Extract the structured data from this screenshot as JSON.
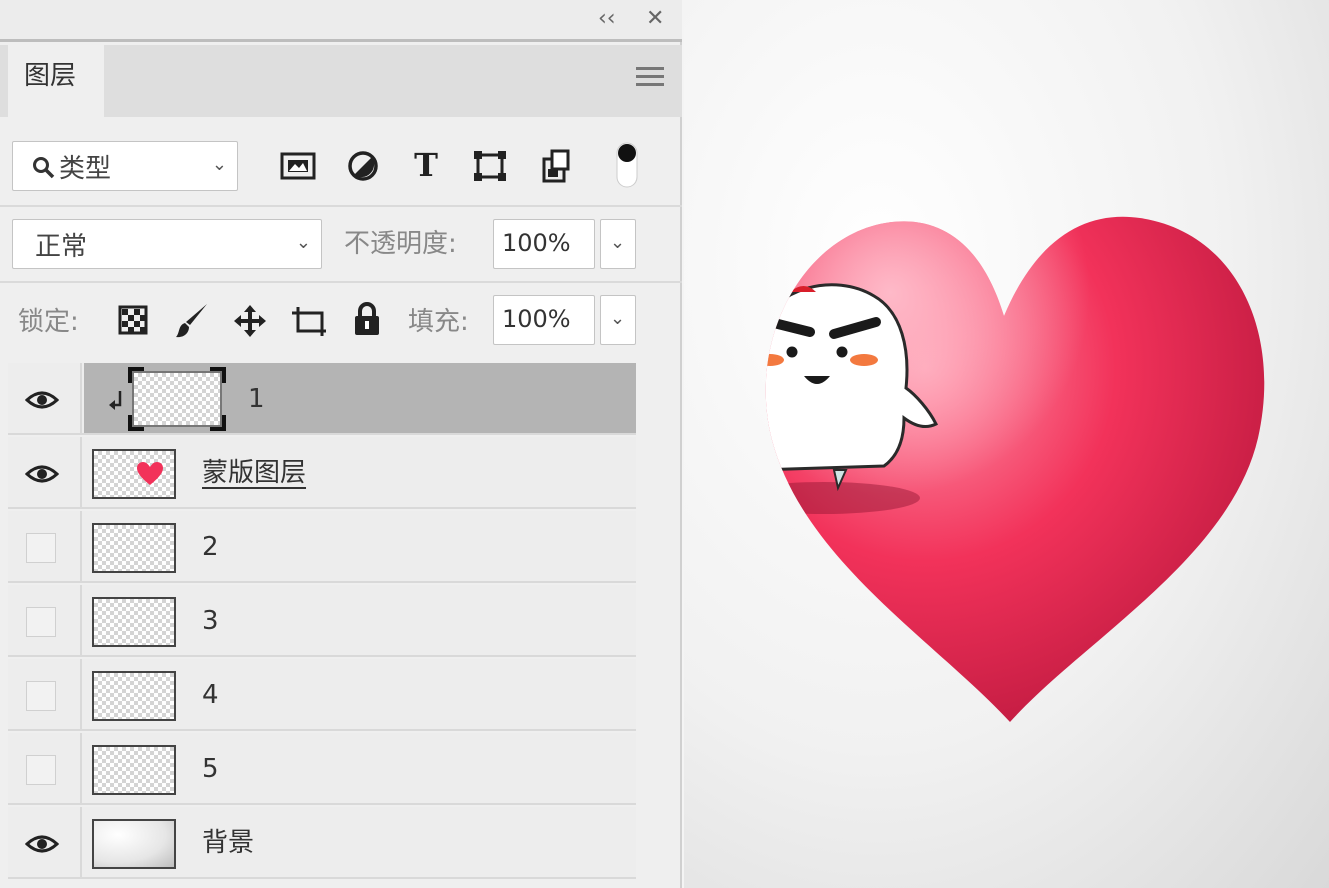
{
  "panel": {
    "collapse_glyph": "‹‹",
    "close_glyph": "✕",
    "tab_label": "图层",
    "menu_icon": "hamburger-menu-icon"
  },
  "filter": {
    "search_icon": "search-icon",
    "kind_value": "类型",
    "icons": [
      "image-filter-icon",
      "adjustment-filter-icon",
      "type-filter-icon",
      "shape-filter-icon",
      "smart-object-filter-icon",
      "filter-toggle-icon"
    ],
    "type_glyph": "T"
  },
  "blend": {
    "mode_value": "正常",
    "opacity_label": "不透明度:",
    "opacity_value": "100%"
  },
  "lock": {
    "label": "锁定:",
    "icons": [
      "lock-transparent-pixels-icon",
      "lock-image-pixels-icon",
      "lock-position-icon",
      "lock-artboard-icon",
      "lock-all-icon"
    ],
    "fill_label": "填充:",
    "fill_value": "100%"
  },
  "layers": [
    {
      "name": "1",
      "visible": true,
      "selected": true,
      "clipped": true,
      "thumb": "transparent"
    },
    {
      "name": "蒙版图层",
      "visible": true,
      "selected": false,
      "clipped": false,
      "thumb": "heart"
    },
    {
      "name": "2",
      "visible": false,
      "selected": false,
      "clipped": false,
      "thumb": "transparent"
    },
    {
      "name": "3",
      "visible": false,
      "selected": false,
      "clipped": false,
      "thumb": "transparent"
    },
    {
      "name": "4",
      "visible": false,
      "selected": false,
      "clipped": false,
      "thumb": "transparent"
    },
    {
      "name": "5",
      "visible": false,
      "selected": false,
      "clipped": false,
      "thumb": "transparent"
    },
    {
      "name": "背景",
      "visible": true,
      "selected": false,
      "clipped": false,
      "thumb": "gradient"
    }
  ],
  "colors": {
    "heart_light": "#ff97ac",
    "heart_main": "#f2325a",
    "heart_dark": "#b5153b",
    "selected_row": "#b4b4b4"
  }
}
